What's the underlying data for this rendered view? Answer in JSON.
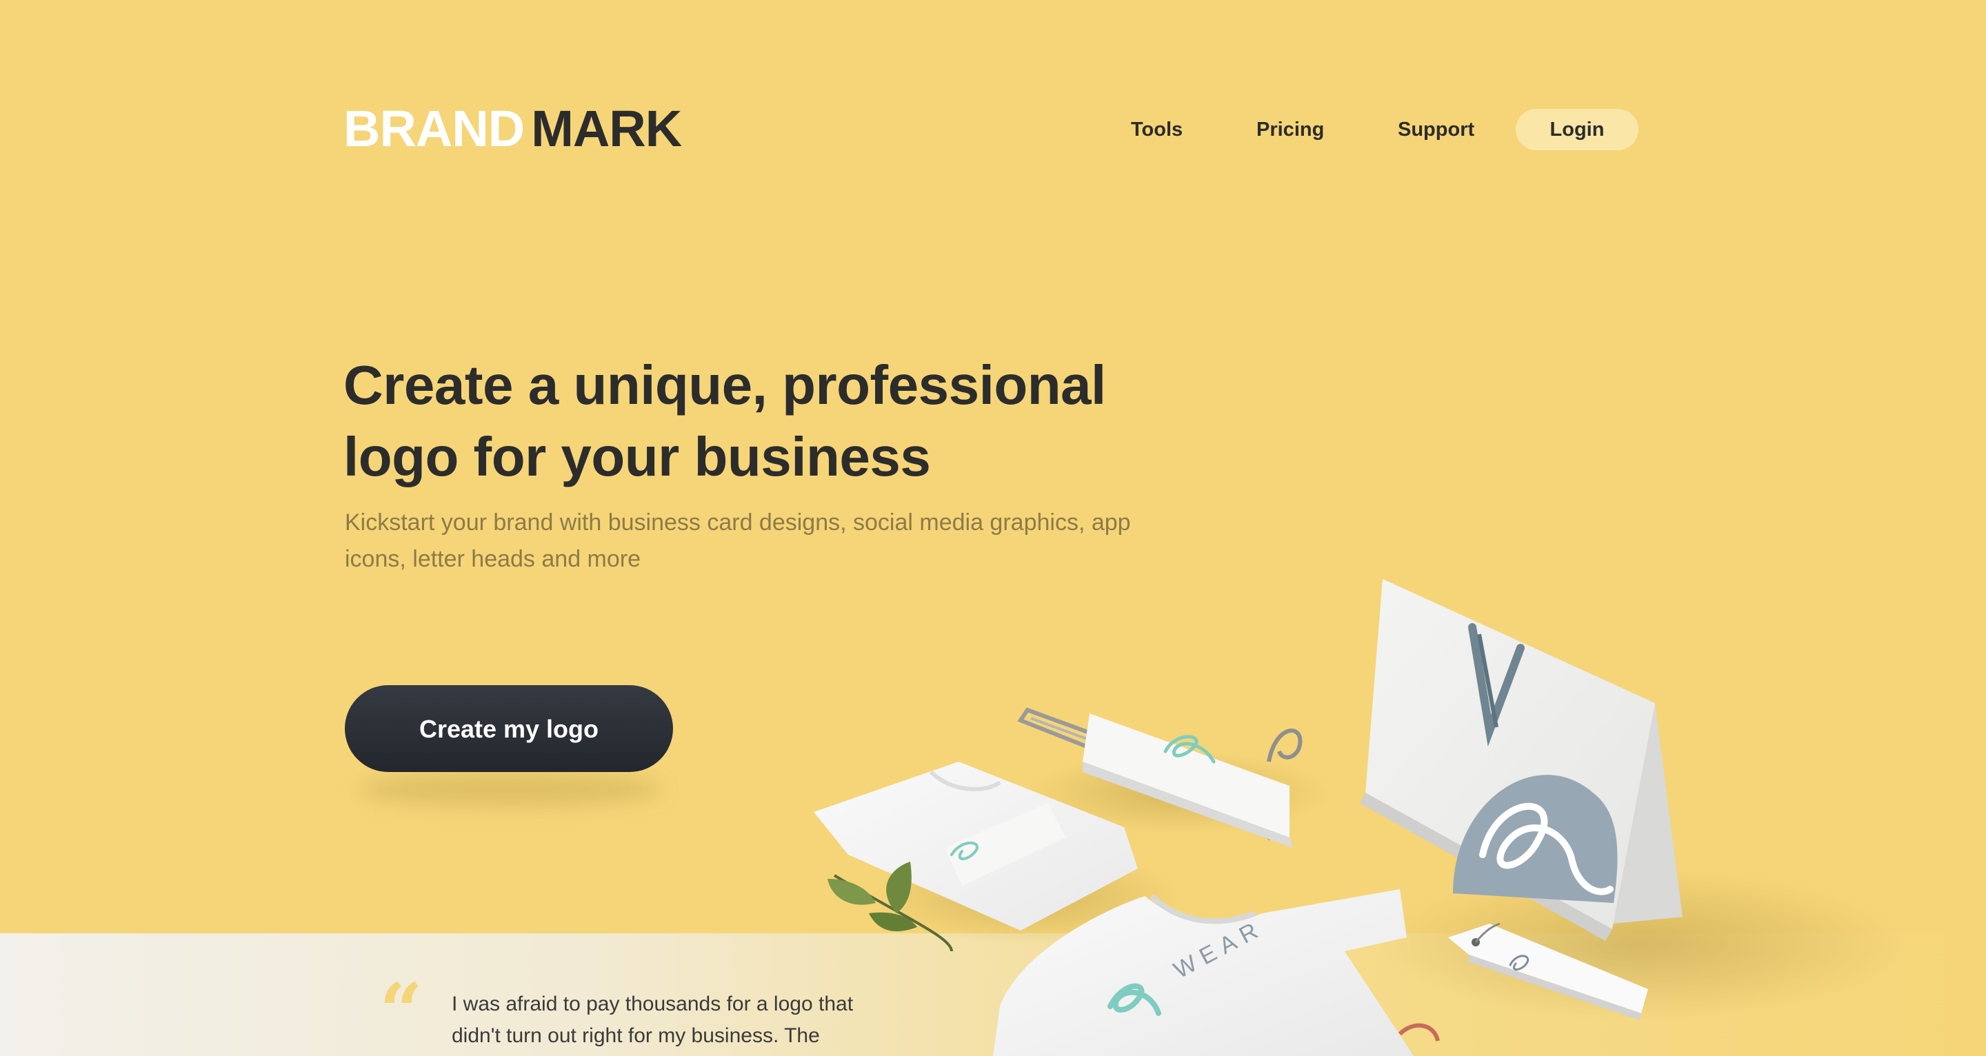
{
  "header": {
    "logo_part1": "BRAND",
    "logo_part2": "MARK",
    "nav": {
      "tools": "Tools",
      "pricing": "Pricing",
      "support": "Support",
      "login": "Login"
    }
  },
  "hero": {
    "title": "Create a unique, professional logo for your business",
    "subtitle": "Kickstart your brand with business card designs, social media graphics, app icons, letter heads and more",
    "cta_label": "Create my logo"
  },
  "testimonial": {
    "quote_mark": "“",
    "text": "I was afraid to pay thousands for a logo that didn't turn out right for my business. The"
  },
  "illustration": {
    "brand_label": "WEAR"
  },
  "colors": {
    "background": "#f5d577",
    "text_dark": "#2c2c2c",
    "subtitle": "#8d7b48",
    "login_pill": "#fae6a7",
    "cta": "#2a2e35",
    "accent_teal": "#7ecdc0",
    "bag_circle": "#97a8b4"
  }
}
